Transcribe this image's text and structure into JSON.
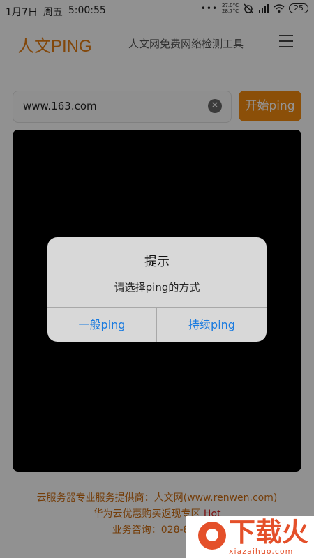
{
  "status_bar": {
    "date": "1月7日",
    "weekday": "周五",
    "time": "5:00:55",
    "dots": "•••",
    "temp_high": "27.0°C",
    "temp_low": "28.7°C",
    "battery": "25"
  },
  "header": {
    "logo": "人文PING",
    "subtitle": "人文网免费网络检测工具"
  },
  "search": {
    "value": "www.163.com",
    "start_label": "开始ping"
  },
  "footer": {
    "line1": "云服务器专业服务提供商：人文网(www.renwen.com)",
    "line2": "华为云优惠购买返现专区",
    "line2_hot": "Hot",
    "line3": "业务咨询：028-866"
  },
  "dialog": {
    "title": "提示",
    "message": "请选择ping的方式",
    "btn_normal": "一般ping",
    "btn_continuous": "持续ping"
  },
  "watermark": {
    "text": "下载火",
    "url": "xiazaihuo.com"
  }
}
